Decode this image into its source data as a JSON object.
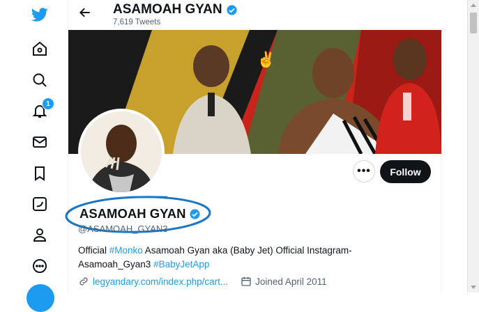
{
  "header": {
    "name": "ASAMOAH GYAN",
    "tweets": "7,619 Tweets"
  },
  "nav": {
    "notifications_badge": "1"
  },
  "profile": {
    "display_name": "ASAMOAH GYAN",
    "handle": "@ASAMOAH_GYAN3",
    "follow_label": "Follow",
    "more_label": "•••",
    "bio": {
      "part1": "Official ",
      "hashtag1": "#Monko",
      "part2": " Asamoah Gyan aka (Baby Jet) Official Instagram- Asamoah_Gyan3 ",
      "hashtag2": "#BabyJetApp"
    },
    "website": "legyandary.com/index.php/cart...",
    "joined": "Joined April 2011"
  },
  "colors": {
    "accent": "#1d9bf0",
    "text": "#0f1419",
    "secondary": "#536471",
    "annotation": "#1877c9"
  }
}
